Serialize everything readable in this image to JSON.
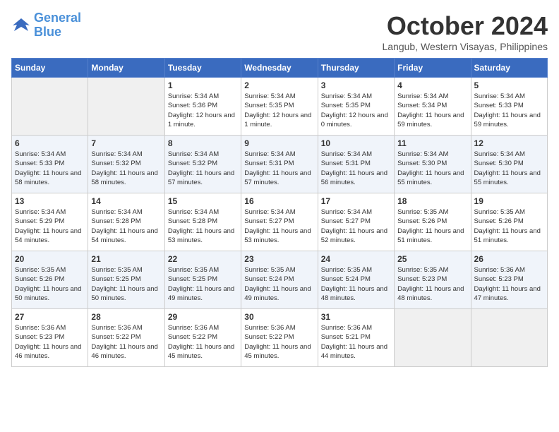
{
  "header": {
    "logo_line1": "General",
    "logo_line2": "Blue",
    "month": "October 2024",
    "location": "Langub, Western Visayas, Philippines"
  },
  "days_of_week": [
    "Sunday",
    "Monday",
    "Tuesday",
    "Wednesday",
    "Thursday",
    "Friday",
    "Saturday"
  ],
  "weeks": [
    [
      {
        "day": "",
        "empty": true
      },
      {
        "day": "",
        "empty": true
      },
      {
        "day": "1",
        "sunrise": "Sunrise: 5:34 AM",
        "sunset": "Sunset: 5:36 PM",
        "daylight": "Daylight: 12 hours and 1 minute."
      },
      {
        "day": "2",
        "sunrise": "Sunrise: 5:34 AM",
        "sunset": "Sunset: 5:35 PM",
        "daylight": "Daylight: 12 hours and 1 minute."
      },
      {
        "day": "3",
        "sunrise": "Sunrise: 5:34 AM",
        "sunset": "Sunset: 5:35 PM",
        "daylight": "Daylight: 12 hours and 0 minutes."
      },
      {
        "day": "4",
        "sunrise": "Sunrise: 5:34 AM",
        "sunset": "Sunset: 5:34 PM",
        "daylight": "Daylight: 11 hours and 59 minutes."
      },
      {
        "day": "5",
        "sunrise": "Sunrise: 5:34 AM",
        "sunset": "Sunset: 5:33 PM",
        "daylight": "Daylight: 11 hours and 59 minutes."
      }
    ],
    [
      {
        "day": "6",
        "sunrise": "Sunrise: 5:34 AM",
        "sunset": "Sunset: 5:33 PM",
        "daylight": "Daylight: 11 hours and 58 minutes."
      },
      {
        "day": "7",
        "sunrise": "Sunrise: 5:34 AM",
        "sunset": "Sunset: 5:32 PM",
        "daylight": "Daylight: 11 hours and 58 minutes."
      },
      {
        "day": "8",
        "sunrise": "Sunrise: 5:34 AM",
        "sunset": "Sunset: 5:32 PM",
        "daylight": "Daylight: 11 hours and 57 minutes."
      },
      {
        "day": "9",
        "sunrise": "Sunrise: 5:34 AM",
        "sunset": "Sunset: 5:31 PM",
        "daylight": "Daylight: 11 hours and 57 minutes."
      },
      {
        "day": "10",
        "sunrise": "Sunrise: 5:34 AM",
        "sunset": "Sunset: 5:31 PM",
        "daylight": "Daylight: 11 hours and 56 minutes."
      },
      {
        "day": "11",
        "sunrise": "Sunrise: 5:34 AM",
        "sunset": "Sunset: 5:30 PM",
        "daylight": "Daylight: 11 hours and 55 minutes."
      },
      {
        "day": "12",
        "sunrise": "Sunrise: 5:34 AM",
        "sunset": "Sunset: 5:30 PM",
        "daylight": "Daylight: 11 hours and 55 minutes."
      }
    ],
    [
      {
        "day": "13",
        "sunrise": "Sunrise: 5:34 AM",
        "sunset": "Sunset: 5:29 PM",
        "daylight": "Daylight: 11 hours and 54 minutes."
      },
      {
        "day": "14",
        "sunrise": "Sunrise: 5:34 AM",
        "sunset": "Sunset: 5:28 PM",
        "daylight": "Daylight: 11 hours and 54 minutes."
      },
      {
        "day": "15",
        "sunrise": "Sunrise: 5:34 AM",
        "sunset": "Sunset: 5:28 PM",
        "daylight": "Daylight: 11 hours and 53 minutes."
      },
      {
        "day": "16",
        "sunrise": "Sunrise: 5:34 AM",
        "sunset": "Sunset: 5:27 PM",
        "daylight": "Daylight: 11 hours and 53 minutes."
      },
      {
        "day": "17",
        "sunrise": "Sunrise: 5:34 AM",
        "sunset": "Sunset: 5:27 PM",
        "daylight": "Daylight: 11 hours and 52 minutes."
      },
      {
        "day": "18",
        "sunrise": "Sunrise: 5:35 AM",
        "sunset": "Sunset: 5:26 PM",
        "daylight": "Daylight: 11 hours and 51 minutes."
      },
      {
        "day": "19",
        "sunrise": "Sunrise: 5:35 AM",
        "sunset": "Sunset: 5:26 PM",
        "daylight": "Daylight: 11 hours and 51 minutes."
      }
    ],
    [
      {
        "day": "20",
        "sunrise": "Sunrise: 5:35 AM",
        "sunset": "Sunset: 5:26 PM",
        "daylight": "Daylight: 11 hours and 50 minutes."
      },
      {
        "day": "21",
        "sunrise": "Sunrise: 5:35 AM",
        "sunset": "Sunset: 5:25 PM",
        "daylight": "Daylight: 11 hours and 50 minutes."
      },
      {
        "day": "22",
        "sunrise": "Sunrise: 5:35 AM",
        "sunset": "Sunset: 5:25 PM",
        "daylight": "Daylight: 11 hours and 49 minutes."
      },
      {
        "day": "23",
        "sunrise": "Sunrise: 5:35 AM",
        "sunset": "Sunset: 5:24 PM",
        "daylight": "Daylight: 11 hours and 49 minutes."
      },
      {
        "day": "24",
        "sunrise": "Sunrise: 5:35 AM",
        "sunset": "Sunset: 5:24 PM",
        "daylight": "Daylight: 11 hours and 48 minutes."
      },
      {
        "day": "25",
        "sunrise": "Sunrise: 5:35 AM",
        "sunset": "Sunset: 5:23 PM",
        "daylight": "Daylight: 11 hours and 48 minutes."
      },
      {
        "day": "26",
        "sunrise": "Sunrise: 5:36 AM",
        "sunset": "Sunset: 5:23 PM",
        "daylight": "Daylight: 11 hours and 47 minutes."
      }
    ],
    [
      {
        "day": "27",
        "sunrise": "Sunrise: 5:36 AM",
        "sunset": "Sunset: 5:23 PM",
        "daylight": "Daylight: 11 hours and 46 minutes."
      },
      {
        "day": "28",
        "sunrise": "Sunrise: 5:36 AM",
        "sunset": "Sunset: 5:22 PM",
        "daylight": "Daylight: 11 hours and 46 minutes."
      },
      {
        "day": "29",
        "sunrise": "Sunrise: 5:36 AM",
        "sunset": "Sunset: 5:22 PM",
        "daylight": "Daylight: 11 hours and 45 minutes."
      },
      {
        "day": "30",
        "sunrise": "Sunrise: 5:36 AM",
        "sunset": "Sunset: 5:22 PM",
        "daylight": "Daylight: 11 hours and 45 minutes."
      },
      {
        "day": "31",
        "sunrise": "Sunrise: 5:36 AM",
        "sunset": "Sunset: 5:21 PM",
        "daylight": "Daylight: 11 hours and 44 minutes."
      },
      {
        "day": "",
        "empty": true
      },
      {
        "day": "",
        "empty": true
      }
    ]
  ]
}
